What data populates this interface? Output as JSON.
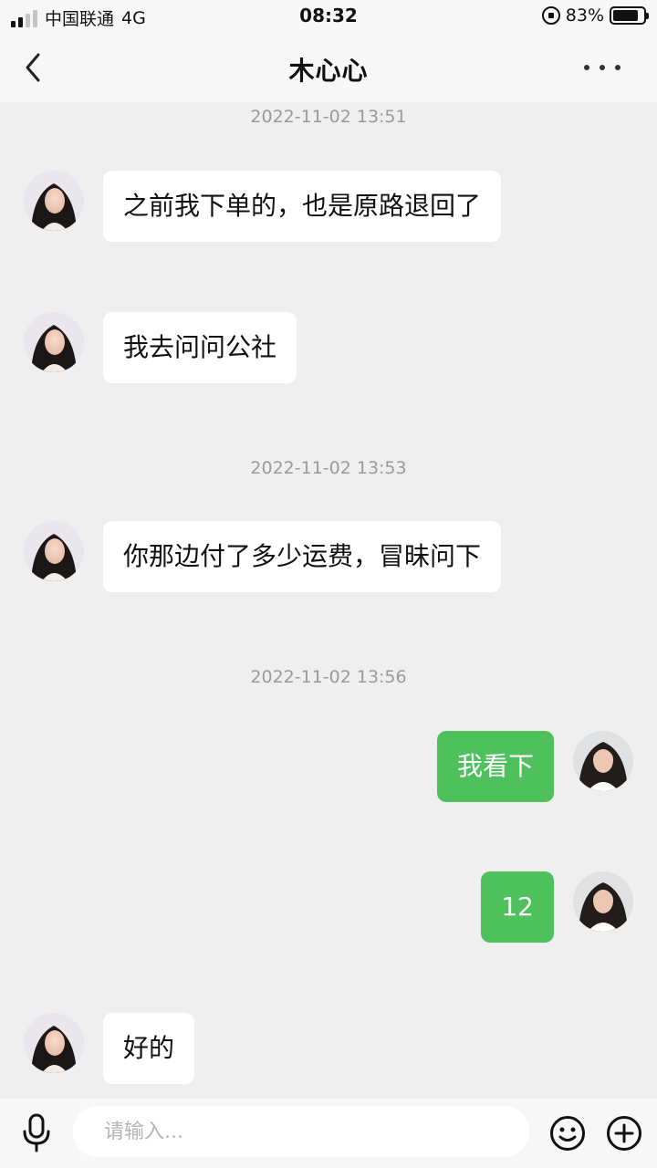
{
  "status_bar": {
    "carrier": "中国联通",
    "network": "4G",
    "time": "08:32",
    "battery_percent": "83%",
    "battery_level": 0.83
  },
  "header": {
    "title": "木心心"
  },
  "messages": [
    {
      "kind": "time",
      "text": "2022-11-02 13:51"
    },
    {
      "kind": "in",
      "text": "之前我下单的，也是原路退回了"
    },
    {
      "kind": "in",
      "text": "我去问问公社"
    },
    {
      "kind": "time",
      "text": "2022-11-02 13:53"
    },
    {
      "kind": "in",
      "text": "你那边付了多少运费，冒昧问下"
    },
    {
      "kind": "time",
      "text": "2022-11-02 13:56"
    },
    {
      "kind": "out",
      "text": "我看下"
    },
    {
      "kind": "out",
      "text": "12"
    },
    {
      "kind": "in",
      "text": "好的"
    }
  ],
  "input": {
    "placeholder": "请输入..."
  },
  "colors": {
    "outgoing_bubble": "#4ec15c",
    "incoming_bubble": "#ffffff",
    "chat_background": "#efefef"
  }
}
